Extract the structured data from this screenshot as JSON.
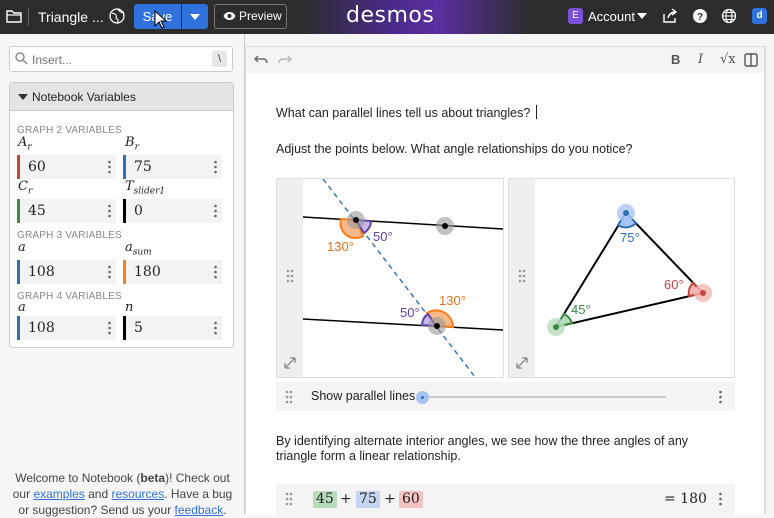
{
  "topbar": {
    "doc_title": "Triangle ...",
    "save_label": "Save",
    "preview_label": "Preview",
    "logo": "desmos",
    "account_badge": "E",
    "account_label": "Account",
    "d_logo": "d",
    "accent": "#2f72dc",
    "icons": [
      "folder-icon",
      "globe-icon",
      "eye-icon",
      "share-icon",
      "help-icon",
      "language-icon"
    ]
  },
  "sidebar": {
    "insert_placeholder": "Insert...",
    "insert_shortcut": "\\",
    "notebook_title": "Notebook Variables",
    "groups": [
      {
        "label": "GRAPH 2 VARIABLES",
        "vars": [
          {
            "name": "A",
            "sub": "r",
            "value": "60",
            "color": "#c74440"
          },
          {
            "name": "B",
            "sub": "r",
            "value": "75",
            "color": "#2d70b3"
          },
          {
            "name": "C",
            "sub": "r",
            "value": "45",
            "color": "#388c46"
          },
          {
            "name": "T",
            "sub": "slider1",
            "value": "0",
            "color": "#000000"
          }
        ]
      },
      {
        "label": "GRAPH 3 VARIABLES",
        "vars": [
          {
            "name": "a",
            "sub": "",
            "value": "108",
            "color": "#2d70b3"
          },
          {
            "name": "a",
            "sub": "sum",
            "value": "180",
            "color": "#fa7e19"
          }
        ]
      },
      {
        "label": "GRAPH 4 VARIABLES",
        "vars": [
          {
            "name": "a",
            "sub": "",
            "value": "108",
            "color": "#2d70b3"
          },
          {
            "name": "n",
            "sub": "",
            "value": "5",
            "color": "#000000"
          }
        ]
      }
    ],
    "welcome": {
      "pre": "Welcome to Notebook (",
      "beta": "beta",
      "mid1": ")! Check out our ",
      "examples": "examples",
      "and": " and ",
      "resources": "resources",
      "mid2": ". Have a bug or suggestion? Send us your ",
      "feedback": "feedback",
      "end": "."
    }
  },
  "editor": {
    "toolbar": {
      "bold": "B",
      "italic": "I",
      "sqrt": "√x"
    },
    "heading_question": "What can parallel lines tell us about triangles?",
    "instruction": "Adjust the points below. What angle relationships do you notice?",
    "graph_left": {
      "angles": [
        "130°",
        "50°",
        "50°",
        "130°"
      ]
    },
    "graph_right": {
      "angles": [
        "75°",
        "60°",
        "45°"
      ]
    },
    "slider_label": "Show parallel lines",
    "conclusion": "By identifying alternate interior angles, we see how the three angles of any triangle form a linear relationship.",
    "expression": {
      "terms": [
        "45",
        "75",
        "60"
      ],
      "plus": "+",
      "result": "= 180"
    }
  }
}
